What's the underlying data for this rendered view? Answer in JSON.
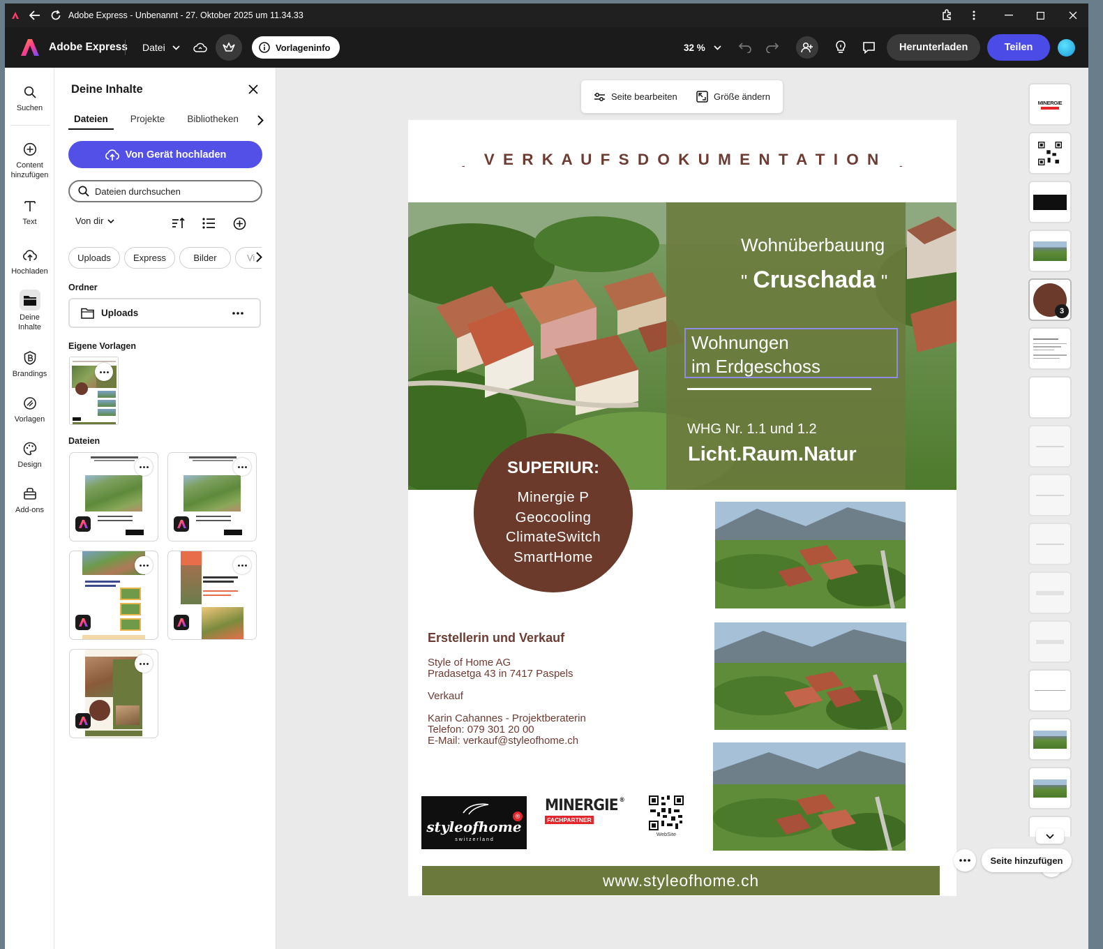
{
  "titlebar": {
    "title": "Adobe Express - Unbenannt - 27. Oktober 2025 um 11.34.33"
  },
  "appbar": {
    "brand": "Adobe Express",
    "file_menu": "Datei",
    "template_info": "Vorlageninfo",
    "zoom": "32 %",
    "download": "Herunterladen",
    "share": "Teilen"
  },
  "rail": [
    {
      "label": "Suchen"
    },
    {
      "label": "Content hinzufügen"
    },
    {
      "label": "Text"
    },
    {
      "label": "Hochladen"
    },
    {
      "label": "Deine Inhalte"
    },
    {
      "label": "Brandings"
    },
    {
      "label": "Vorlagen"
    },
    {
      "label": "Design"
    },
    {
      "label": "Add-ons"
    }
  ],
  "panel": {
    "title": "Deine Inhalte",
    "tabs": [
      "Dateien",
      "Projekte",
      "Bibliotheken"
    ],
    "upload_button": "Von Gerät hochladen",
    "search_placeholder": "Dateien durchsuchen",
    "sort_label": "Von dir",
    "chips": [
      "Uploads",
      "Express",
      "Bilder",
      "Vi"
    ],
    "folders_heading": "Ordner",
    "folder_name": "Uploads",
    "templates_heading": "Eigene Vorlagen",
    "files_heading": "Dateien"
  },
  "canvas_toolbar": {
    "edit_page": "Seite bearbeiten",
    "resize": "Größe ändern"
  },
  "document": {
    "heading": "V E R K A U F S D O K U M E N T A T I O N",
    "dash": "-",
    "project_line1": "Wohnüberbauung",
    "project_quote_open": "\"",
    "project_name": "Cruschada",
    "project_quote_close": "\"",
    "units_line1": "Wohnungen",
    "units_line2": "im Erdgeschoss",
    "whg": "WHG Nr. 1.1 und 1.2",
    "slogan": "Licht.Raum.Natur",
    "badge_title": "SUPERIUR:",
    "badge_lines": [
      "Minergie P",
      "Geocooling",
      "ClimateSwitch",
      "SmartHome"
    ],
    "contact_heading": "Erstellerin und Verkauf",
    "company": "Style of Home AG",
    "address": "Pradasetga 43 in 7417 Paspels",
    "sales_label": "Verkauf",
    "contact_person": "Karin Cahannes - Projektberaterin",
    "phone": "Telefon: 079 301 20 00",
    "email": "E-Mail: verkauf@styleofhome.ch",
    "logo_styleofhome": "styleofhome",
    "logo_switzerland": "s w i t z e r l a n d",
    "logo_registered": "®",
    "logo_minergie": "MINERGIE",
    "logo_minergie_reg": "®",
    "logo_fachpartner": "FACHPARTNER",
    "qr_caption": "WebSite",
    "website": "www.styleofhome.ch"
  },
  "strip": {
    "badge_count": "3",
    "add_page": "Seite hinzufügen"
  },
  "colors": {
    "accent": "#5350e8",
    "olive": "#6b7a3c",
    "brown": "#6b3a2a",
    "heading_brown": "#6d3b32",
    "minergie_red": "#e3262b"
  }
}
